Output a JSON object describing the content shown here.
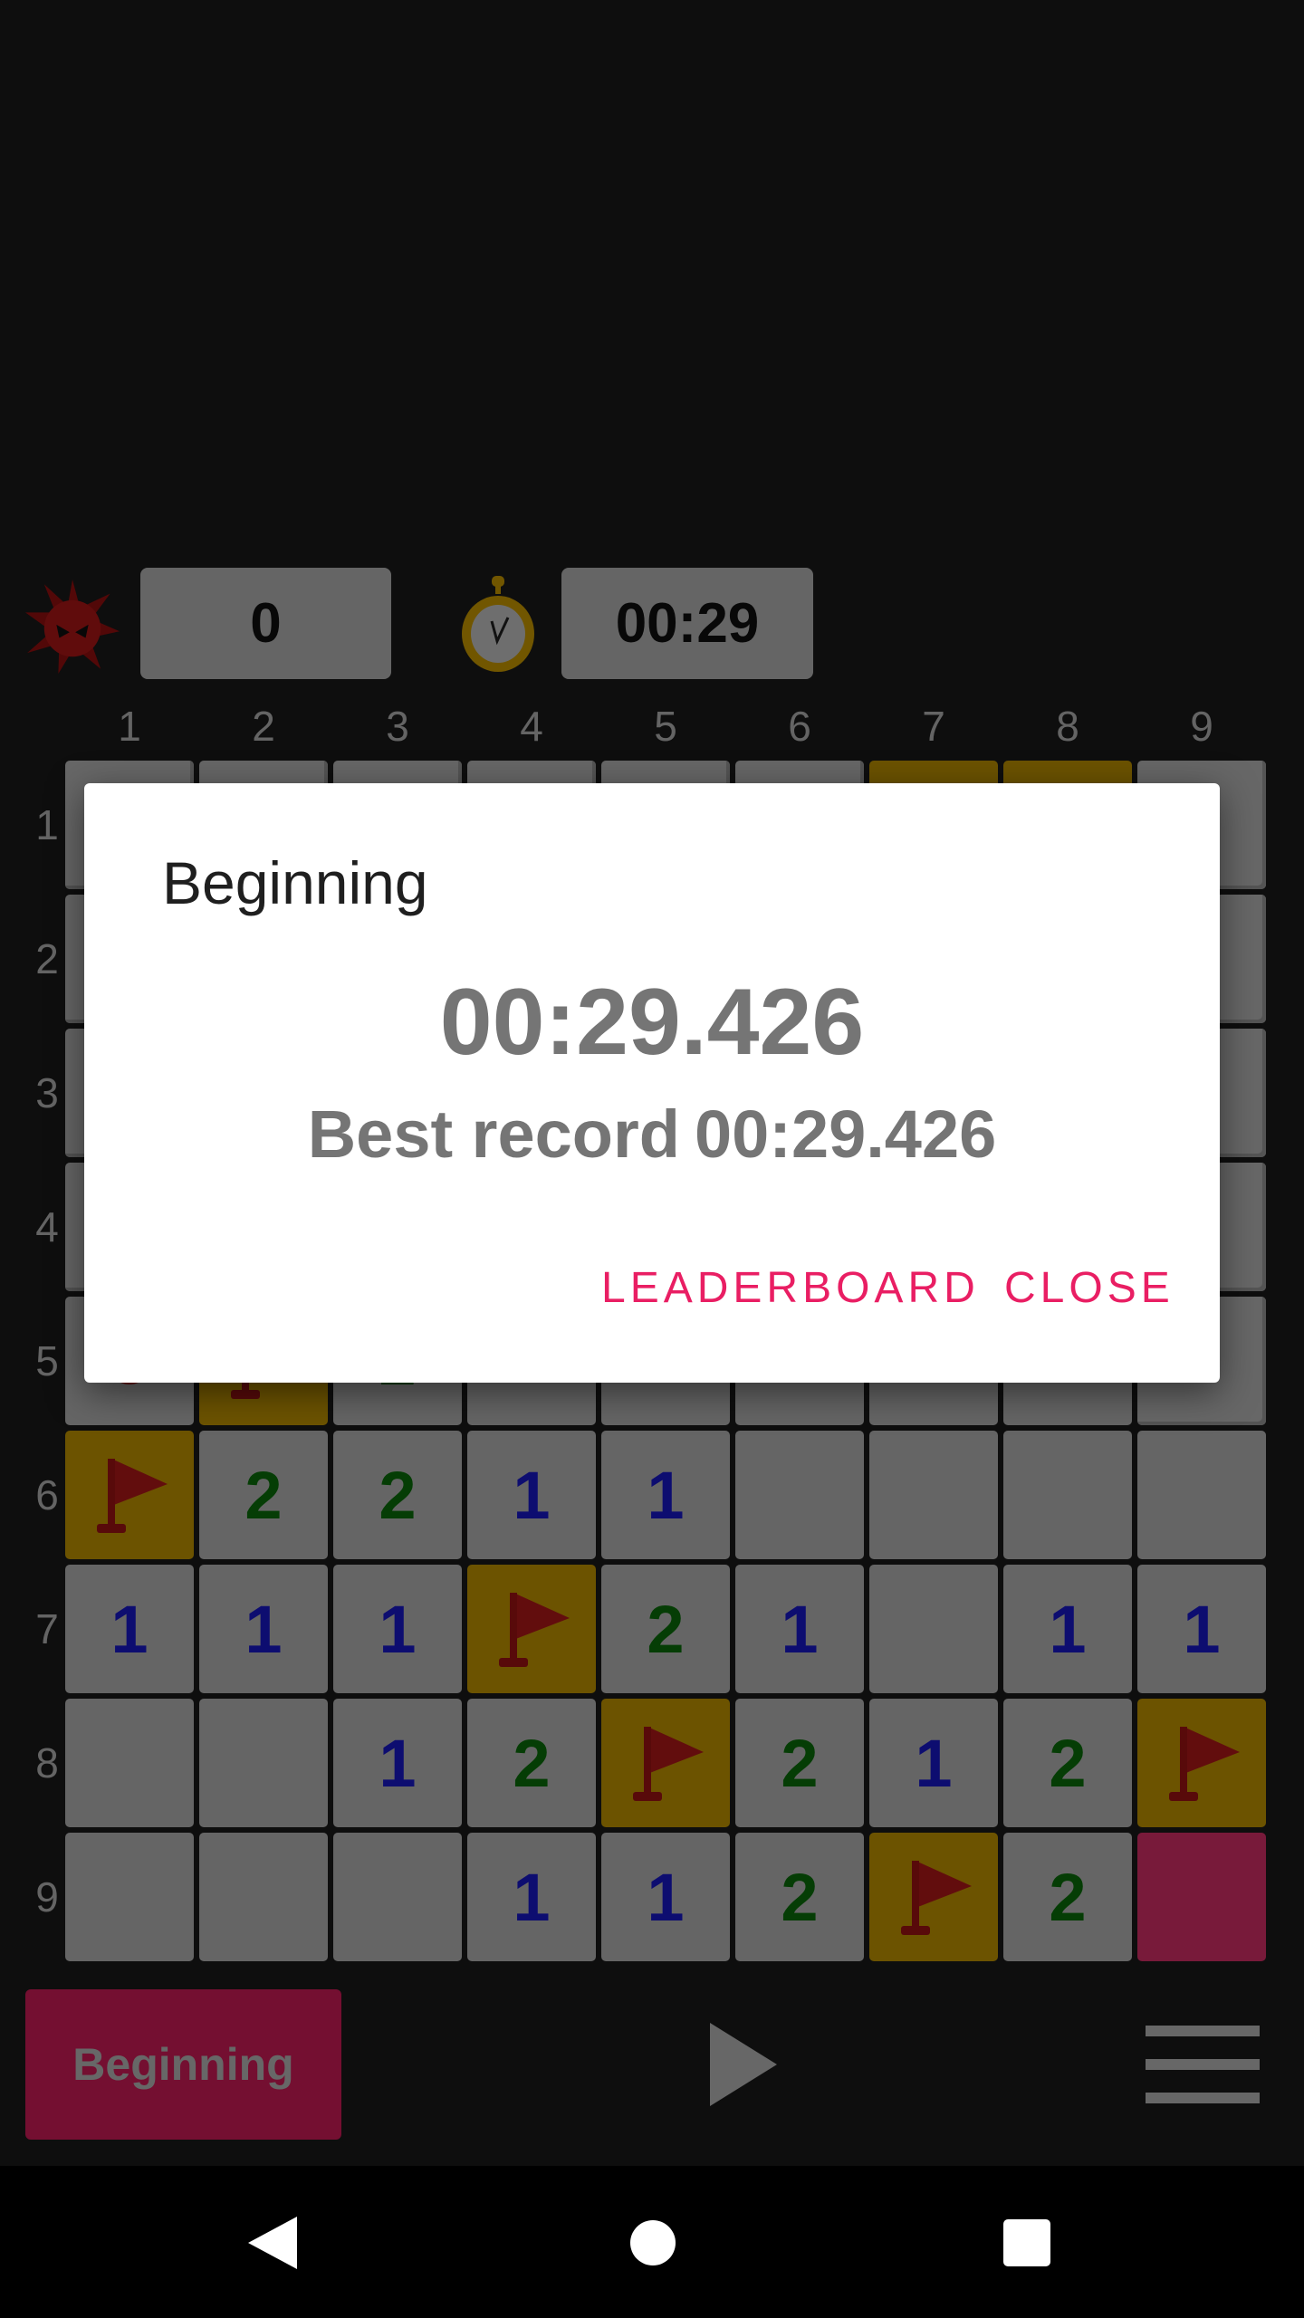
{
  "status": {
    "mines_remaining": "0",
    "timer": "00:29"
  },
  "columns": [
    "1",
    "2",
    "3",
    "4",
    "5",
    "6",
    "7",
    "8",
    "9"
  ],
  "rows": [
    "1",
    "2",
    "3",
    "4",
    "5",
    "6",
    "7",
    "8",
    "9"
  ],
  "board": [
    [
      "h",
      "h",
      "h",
      "h",
      "h",
      "h",
      "F",
      "F",
      "h"
    ],
    [
      "h",
      "h",
      "h",
      "h",
      "h",
      "h",
      "h",
      "h",
      "h"
    ],
    [
      "h",
      "h",
      "h",
      "h",
      "h",
      "h",
      "h",
      "h",
      "h"
    ],
    [
      "h",
      "h",
      "h",
      "h",
      "h",
      "h",
      "h",
      "h",
      "h"
    ],
    [
      "M",
      "F",
      "2",
      "",
      "",
      "",
      "",
      "",
      "h"
    ],
    [
      "F",
      "2",
      "2",
      "1",
      "1",
      "",
      "",
      "",
      ""
    ],
    [
      "1",
      "1",
      "1",
      "F",
      "2",
      "1",
      "",
      "1",
      "1"
    ],
    [
      "",
      "",
      "1",
      "2",
      "F",
      "2",
      "1",
      "2",
      "F"
    ],
    [
      "",
      "",
      "",
      "1",
      "1",
      "2",
      "F",
      "2",
      "X"
    ]
  ],
  "colors": {
    "accent": "#e91e63",
    "flag_cell": "#d8a700",
    "revealed_cell": "#cbcbcb",
    "one": "#1a1ae0",
    "two": "#0b7a0b"
  },
  "bottom_bar": {
    "difficulty_label": "Beginning",
    "play_icon": "play-icon",
    "menu_icon": "hamburger-menu-icon"
  },
  "dialog": {
    "title": "Beginning",
    "time": "00:29.426",
    "best_label": "Best record",
    "best_time": "00:29.426",
    "leaderboard_label": "LEADERBOARD",
    "close_label": "CLOSE"
  },
  "navbar": {
    "back_icon": "back-icon",
    "home_icon": "home-icon",
    "recents_icon": "recents-icon"
  }
}
